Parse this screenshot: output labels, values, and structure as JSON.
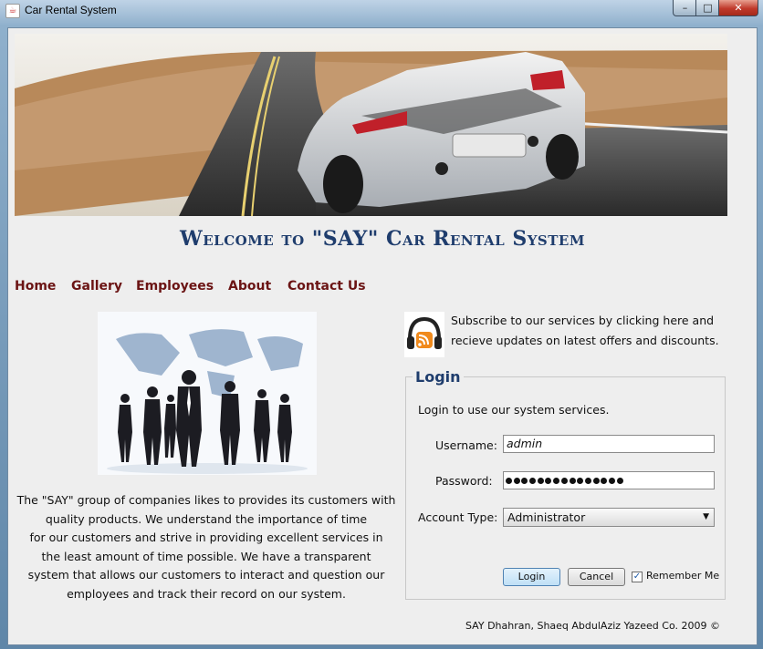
{
  "window": {
    "title": "Car Rental System",
    "app_icon": "java-cup-icon",
    "controls": {
      "minimize": "–",
      "maximize": "□",
      "close": "✕"
    }
  },
  "banner": {
    "image": "convertible-sports-car-on-road"
  },
  "welcome": "Welcome to \"SAY\" Car Rental System",
  "nav": [
    "Home",
    "Gallery",
    "Employees",
    "About",
    "Contact Us"
  ],
  "people_image": "business-people-world-map",
  "description": [
    "The \"SAY\" group of companies likes to provides its customers with",
    "quality products. We understand the importance of time",
    "for our customers and strive in providing excellent services in",
    "the least amount of time possible. We have a transparent",
    "system that allows our customers to interact and question our",
    "employees and track their record on our system."
  ],
  "subscribe": {
    "icon": "rss-headphones-icon",
    "lines": [
      "Subscribe to our services by clicking here and",
      "recieve updates on latest offers and discounts."
    ]
  },
  "login": {
    "title": "Login",
    "info": "Login to use our system services.",
    "username_label": "Username:",
    "username_value": "admin",
    "password_label": "Password:",
    "password_length": 15,
    "account_type_label": "Account Type:",
    "account_type_value": "Administrator",
    "login_button": "Login",
    "cancel_button": "Cancel",
    "remember_label": "Remember Me",
    "remember_checked": true
  },
  "footer": "SAY Dhahran, Shaeq AbdulAziz Yazeed Co. 2009 ©",
  "colors": {
    "heading": "#1f3d6d",
    "nav": "#6b1414"
  }
}
